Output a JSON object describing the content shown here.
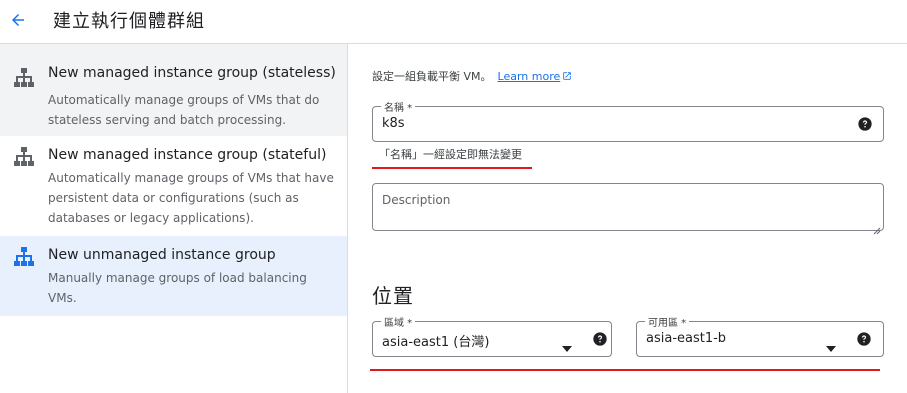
{
  "header": {
    "title": "建立執行個體群組"
  },
  "options": [
    {
      "title": "New managed instance group (stateless)",
      "desc": "Automatically manage groups of VMs that do stateless serving and batch processing."
    },
    {
      "title": "New managed instance group (stateful)",
      "desc": "Automatically manage groups of VMs that have persistent data or configurations (such as databases or legacy applications)."
    },
    {
      "title": "New unmanaged instance group",
      "desc": "Manually manage groups of load balancing VMs."
    }
  ],
  "form": {
    "intro": "設定一組負載平衡 VM。",
    "learn_more": "Learn more",
    "name": {
      "label": "名稱 *",
      "value": "k8s",
      "help": "「名稱」一經設定即無法變更"
    },
    "description": {
      "placeholder": "Description",
      "value": ""
    },
    "location": {
      "title": "位置",
      "region": {
        "label": "區域 *",
        "value": "asia-east1 (台灣)"
      },
      "zone": {
        "label": "可用區 *",
        "value": "asia-east1-b"
      }
    }
  },
  "colors": {
    "accent": "#1a73e8",
    "annotation": "#e0191e",
    "selected_bg": "#e8f0fe",
    "hover_bg": "#f1f3f4"
  }
}
